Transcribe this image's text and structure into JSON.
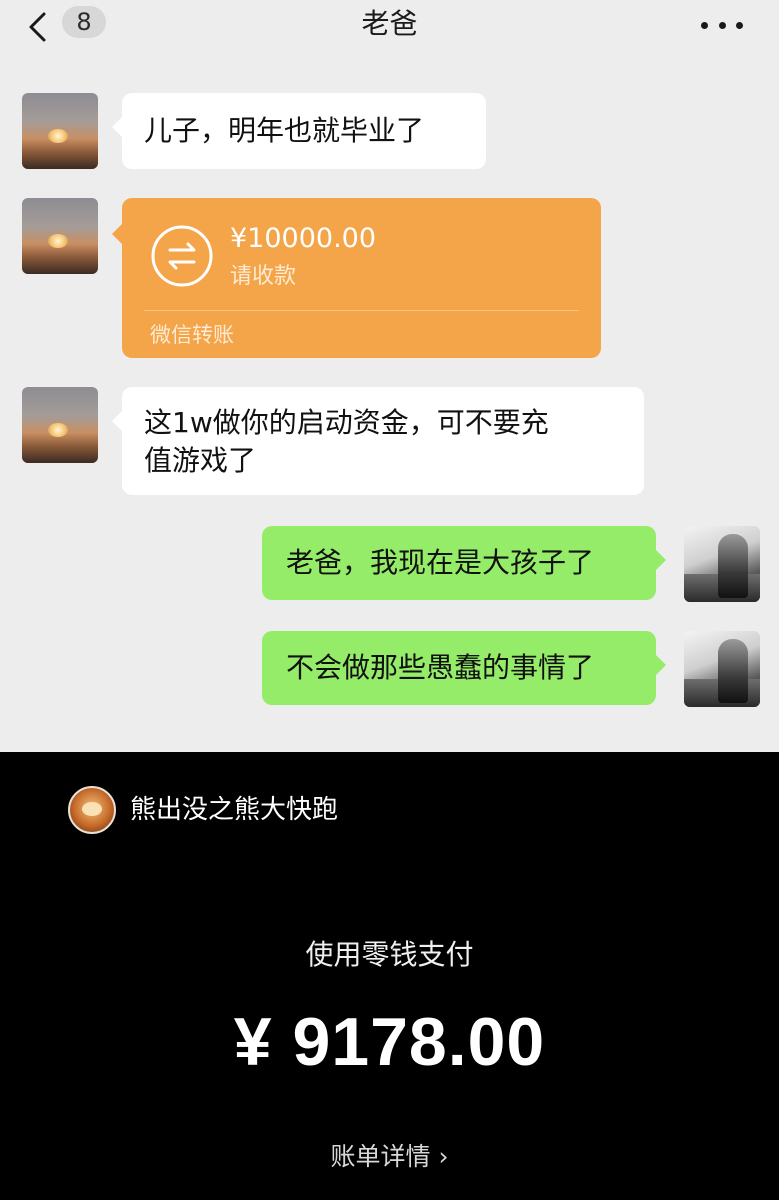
{
  "header": {
    "back_icon": "chevron-left-icon",
    "unread_count": "8",
    "title": "老爸",
    "more_icon": "more-dots-icon"
  },
  "messages": [
    {
      "side": "left",
      "type": "text",
      "text": "儿子，明年也就毕业了"
    },
    {
      "side": "left",
      "type": "transfer",
      "amount": "¥10000.00",
      "status": "请收款",
      "footer": "微信转账",
      "icon": "transfer-arrows-icon"
    },
    {
      "side": "left",
      "type": "text",
      "lines": [
        "这1w做你的启动资金，可不要充",
        "值游戏了"
      ]
    },
    {
      "side": "right",
      "type": "text",
      "text": "老爸，我现在是大孩子了"
    },
    {
      "side": "right",
      "type": "text",
      "text": "不会做那些愚蠢的事情了"
    }
  ],
  "payment": {
    "merchant_name": "熊出没之熊大快跑",
    "method": "使用零钱支付",
    "amount": "¥ 9178.00",
    "details_link": "账单详情",
    "details_icon": "chevron-right-icon"
  },
  "colors": {
    "chat_bg": "#ededed",
    "bubble_left": "#ffffff",
    "bubble_right": "#95ec69",
    "transfer_orange": "#f4a449",
    "payment_bg": "#000000"
  }
}
